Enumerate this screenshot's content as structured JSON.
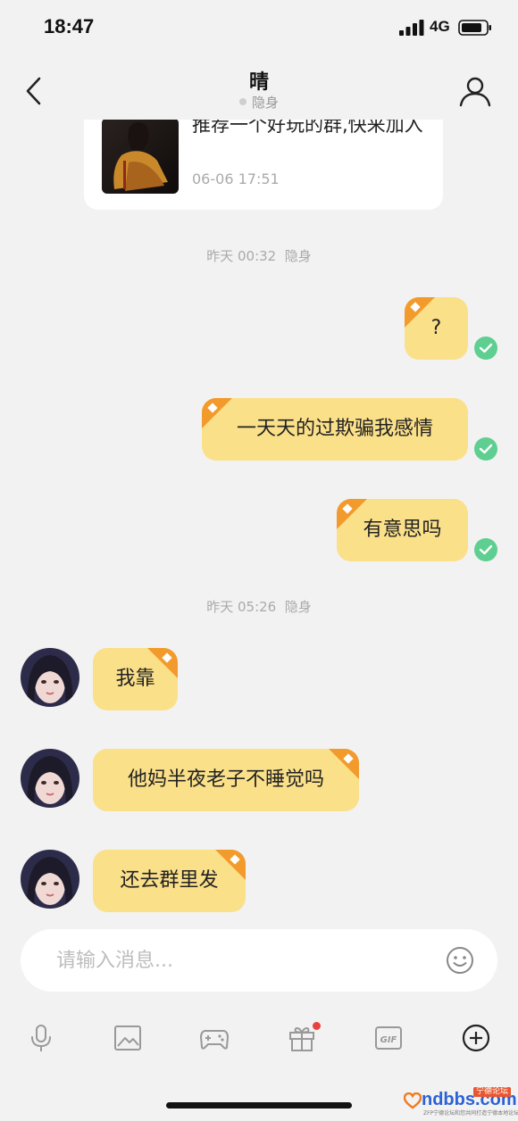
{
  "status_bar": {
    "time": "18:47",
    "network": "4G"
  },
  "header": {
    "title": "晴",
    "presence": "隐身"
  },
  "share_card": {
    "text": "推荐一个好玩的群,快来加入",
    "time": "06-06 17:51"
  },
  "timestamps": [
    {
      "time": "昨天 00:32",
      "status": "隐身"
    },
    {
      "time": "昨天 05:26",
      "status": "隐身"
    }
  ],
  "outgoing": [
    {
      "text": "?"
    },
    {
      "text": "一天天的过欺骗我感情"
    },
    {
      "text": "有意思吗"
    }
  ],
  "incoming": [
    {
      "text": "我靠"
    },
    {
      "text": "他妈半夜老子不睡觉吗"
    },
    {
      "text": "还去群里发"
    }
  ],
  "composer": {
    "placeholder": "请输入消息..."
  },
  "toolbar": {
    "items": [
      {
        "icon": "microphone-icon"
      },
      {
        "icon": "image-icon"
      },
      {
        "icon": "game-icon"
      },
      {
        "icon": "gift-icon"
      },
      {
        "icon": "gif-icon",
        "label": "GIF"
      },
      {
        "icon": "plus-circle-icon"
      }
    ]
  },
  "watermark": {
    "text": "ndbbs.com",
    "tag": "宁德论坛",
    "sub": "ZFP宁德论坛和您共同打造宁德本地论坛"
  },
  "colors": {
    "bubble": "#fbe08a",
    "corner_badge": "#f39a2c",
    "check": "#5ecf90",
    "background": "#f2f2f2",
    "notification_dot": "#e8423c"
  }
}
